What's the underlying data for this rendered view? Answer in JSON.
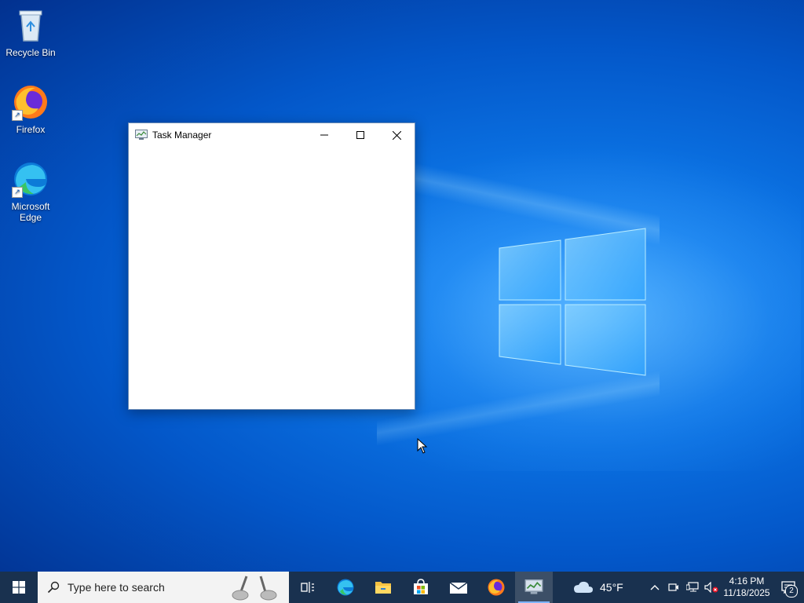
{
  "desktop": {
    "icons": [
      {
        "label": "Recycle Bin",
        "icon": "recycle-bin-icon"
      },
      {
        "label": "Firefox",
        "icon": "firefox-icon"
      },
      {
        "label": "Microsoft Edge",
        "icon": "edge-icon"
      }
    ]
  },
  "window": {
    "title": "Task Manager",
    "icon": "task-manager-icon",
    "controls": [
      "minimize-icon",
      "maximize-icon",
      "close-icon"
    ]
  },
  "taskbar": {
    "search_placeholder": "Type here to search",
    "apps": [
      "task-view-icon",
      "edge-icon",
      "file-explorer-icon",
      "store-icon",
      "mail-icon",
      "firefox-icon",
      "task-manager-icon"
    ],
    "active_app": "task-manager-icon",
    "weather": {
      "temp": "45°F",
      "icon": "cloud-icon"
    },
    "clock": {
      "time": "4:16 PM",
      "date": "11/18/2025"
    },
    "notifications": {
      "count": "2"
    }
  },
  "colors": {
    "accent": "#0a6fe0",
    "taskbar": "#19314f"
  }
}
